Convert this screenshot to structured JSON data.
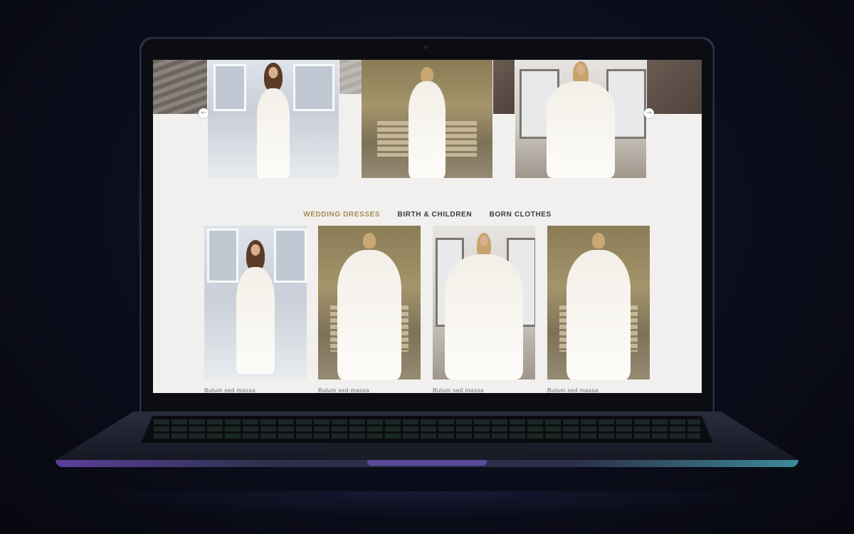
{
  "gallery": {
    "prev_arrow": "←",
    "next_arrow": "→"
  },
  "tabs": [
    {
      "label": "WEDDING DRESSES",
      "active": true
    },
    {
      "label": "BIRTH & CHILDREN",
      "active": false
    },
    {
      "label": "BORN CLOTHES",
      "active": false
    }
  ],
  "products": [
    {
      "caption": "Bulum sed massa"
    },
    {
      "caption": "Bulum sed massa"
    },
    {
      "caption": "Bulum sed massa"
    },
    {
      "caption": "Bulum sed massa"
    }
  ],
  "colors": {
    "accent": "#a58d55",
    "tab_text": "#3a3a3a",
    "page_background": "#f2f0ee"
  }
}
